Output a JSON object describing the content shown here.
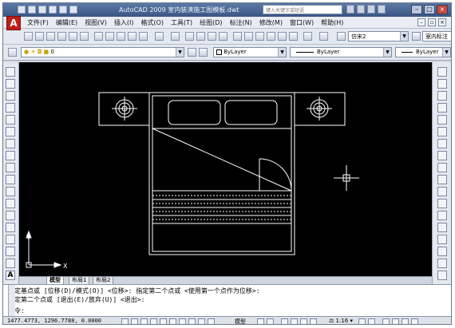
{
  "window": {
    "title": "AutoCAD 2009  室内装潢施工图模板.dwt",
    "search_placeholder": "键入关键字或短语",
    "app_button": "A"
  },
  "menu": {
    "items": [
      "文件(F)",
      "编辑(E)",
      "视图(V)",
      "插入(I)",
      "格式(O)",
      "工具(T)",
      "绘图(D)",
      "标注(N)",
      "修改(M)",
      "窗口(W)",
      "帮助(H)"
    ]
  },
  "toolbar1": {
    "text_style": "仿宋2",
    "dim_style": "室内标注"
  },
  "toolbar2": {
    "layer": "0",
    "color": "ByLayer",
    "linetype": "ByLayer",
    "lineweight": "ByLayer"
  },
  "tabs": [
    "模型",
    "布局1",
    "布局2"
  ],
  "ucs": {
    "x": "X",
    "y": "Y"
  },
  "command": {
    "line1": "指定基点或 [位移(D)/模式(O)] <位移>: 指定第二个点或 <使用第一个点作为位移>:",
    "line2": "指定第二个点或 [退出(E)/放弃(U)] <退出>:",
    "prompt": "命令:"
  },
  "status": {
    "coords": "1477.4773, 1296.7788, 0.0000",
    "model": "模型",
    "scale": "1:16"
  },
  "colors": {
    "canvas": "#000000",
    "drawing_lines": "#ffffff",
    "title_bar": "#3a5583",
    "app_button": "#c21d18"
  }
}
